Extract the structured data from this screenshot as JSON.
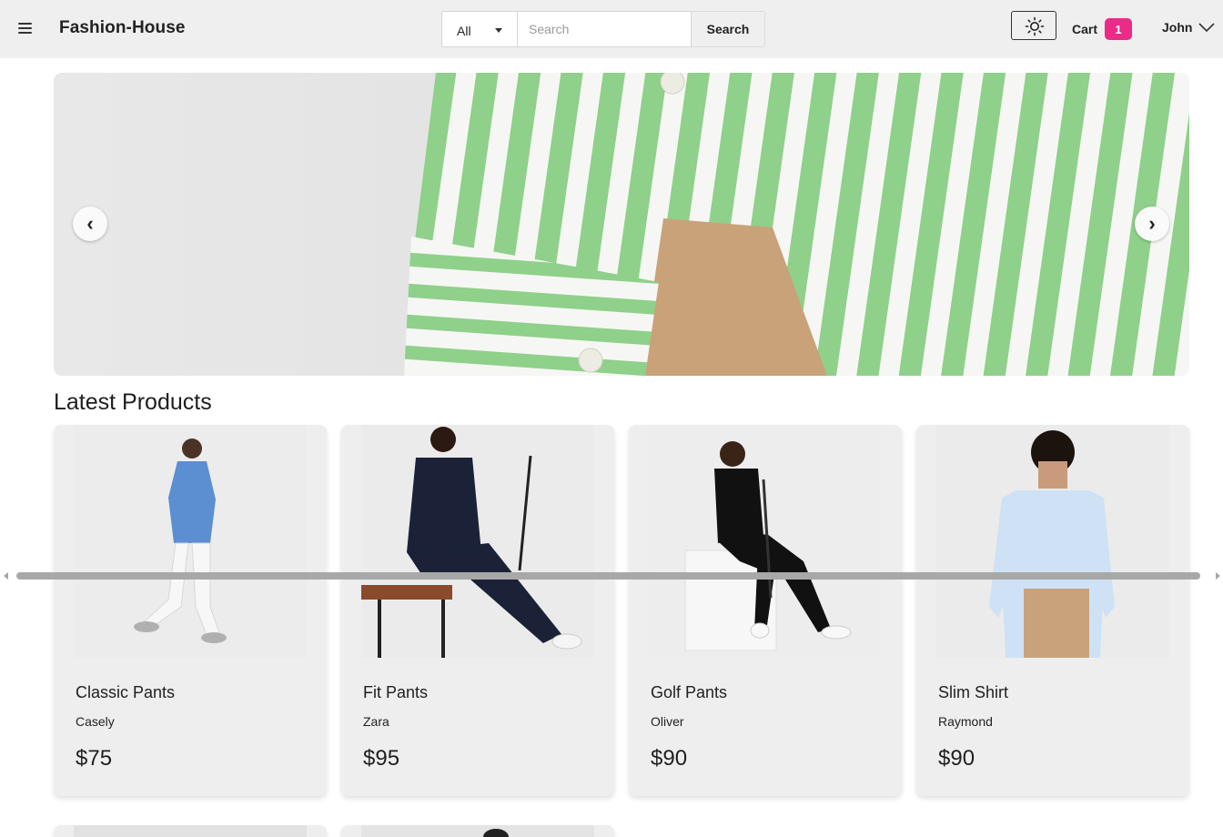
{
  "header": {
    "brand": "Fashion-House",
    "category_select": {
      "selected": "All"
    },
    "search": {
      "placeholder": "Search",
      "value": "",
      "button_label": "Search"
    },
    "theme_toggle_icon": "sun-icon",
    "cart": {
      "label": "Cart",
      "count": "1",
      "badge_color": "#ec2a87"
    },
    "user": {
      "name": "John"
    }
  },
  "carousel": {
    "prev_label": "‹",
    "next_label": "›",
    "image_alt": "Green striped shirt"
  },
  "main": {
    "section_title": "Latest Products",
    "products": [
      {
        "name": "Classic Pants",
        "brand": "Casely",
        "price": "$75"
      },
      {
        "name": "Fit Pants",
        "brand": "Zara",
        "price": "$95"
      },
      {
        "name": "Golf Pants",
        "brand": "Oliver",
        "price": "$90"
      },
      {
        "name": "Slim Shirt",
        "brand": "Raymond",
        "price": "$90"
      }
    ]
  },
  "colors": {
    "header_bg": "#efefef",
    "card_bg": "#eeeeee",
    "accent": "#ec2a87"
  }
}
